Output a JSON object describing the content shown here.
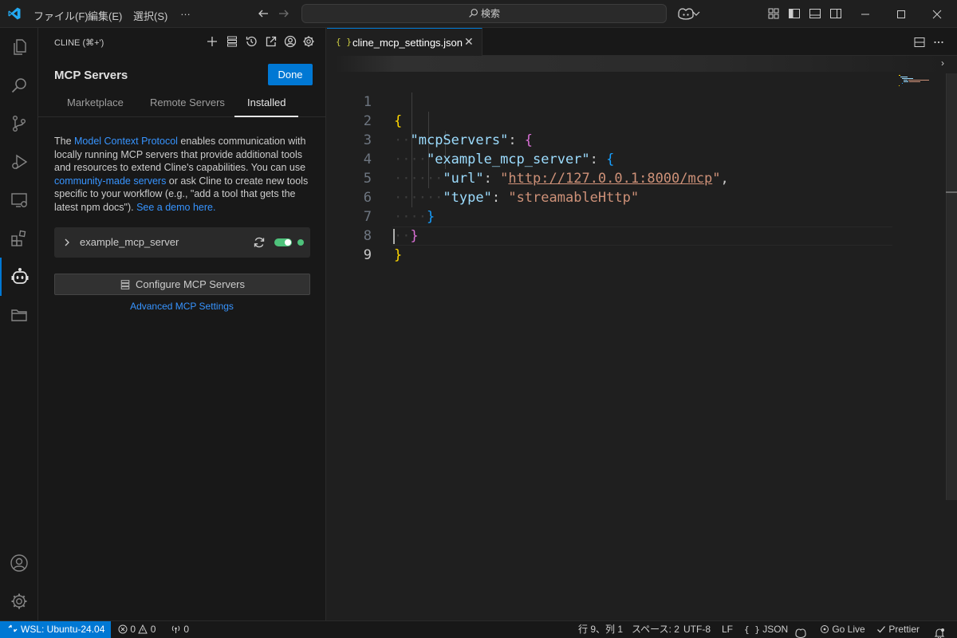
{
  "titlebar": {
    "menu": [
      "ファイル(F)",
      "編集(E)",
      "選択(S)",
      "…"
    ],
    "search_text": "検索"
  },
  "sidebar": {
    "view_title": "CLINE (⌘+')",
    "heading": "MCP Servers",
    "done_label": "Done",
    "tabs": [
      {
        "label": "Marketplace",
        "active": false
      },
      {
        "label": "Remote Servers",
        "active": false
      },
      {
        "label": "Installed",
        "active": true
      }
    ],
    "description": {
      "t1": "The ",
      "link1": "Model Context Protocol",
      "t2": " enables communication with locally running MCP servers that provide additional tools and resources to extend Cline's capabilities. You can use ",
      "link2": "community-made servers",
      "t3": " or ask Cline to create new tools specific to your workflow (e.g., \"add a tool that gets the latest npm docs\"). ",
      "link3": "See a demo here."
    },
    "server": {
      "name": "example_mcp_server",
      "enabled": true,
      "status_color": "#4ec27b"
    },
    "configure_label": "Configure MCP Servers",
    "advanced_label": "Advanced MCP Settings"
  },
  "editor": {
    "tab_icon": "{ }",
    "tab_label": "cline_mcp_settings.json",
    "tab_close": "✕",
    "line_numbers": [
      "1",
      "2",
      "3",
      "4",
      "5",
      "6",
      "7",
      "8",
      "9"
    ],
    "code": {
      "l1_open": "{",
      "l2_key": "\"mcpServers\"",
      "l2_colon": ": ",
      "l2_open": "{",
      "l3_key": "\"example_mcp_server\"",
      "l3_colon": ": ",
      "l3_open": "{",
      "l4_key": "\"url\"",
      "l4_colon": ": ",
      "l4_q1": "\"",
      "l4_url": "http://127.0.0.1:8000/mcp",
      "l4_q2": "\"",
      "l4_comma": ",",
      "l5_key": "\"type\"",
      "l5_colon": ": ",
      "l5_value": "\"streamableHttp\"",
      "l6_close": "}",
      "l7_close": "}",
      "l8_close": "}"
    }
  },
  "statusbar": {
    "remote": "WSL: Ubuntu-24.04",
    "errors": "0",
    "warnings": "0",
    "ports": "0",
    "cursor": "行 9、列 1",
    "spaces": "スペース: 2",
    "encoding": "UTF-8",
    "eol": "LF",
    "lang_icon": "{ }",
    "language": "JSON",
    "golive": "Go Live",
    "prettier": "Prettier"
  },
  "colors": {
    "accent": "#0078d4",
    "link": "#3794ff",
    "toggle_on": "#4ec27b"
  }
}
